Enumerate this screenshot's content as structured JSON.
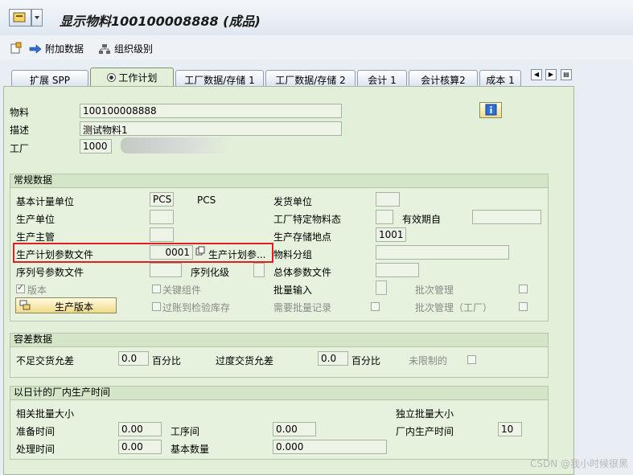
{
  "window": {
    "title": "显示物料100100008888 (成品)"
  },
  "toolbar": {
    "additional_data": "附加数据",
    "org_levels": "组织级别"
  },
  "tabs": [
    {
      "label": "扩展 SPP"
    },
    {
      "label": "工作计划"
    },
    {
      "label": "工厂数据/存储 1"
    },
    {
      "label": "工厂数据/存储 2"
    },
    {
      "label": "会计 1"
    },
    {
      "label": "会计核算2"
    },
    {
      "label": "成本 1"
    }
  ],
  "header": {
    "material_label": "物料",
    "material_value": "100100008888",
    "desc_label": "描述",
    "desc_value": "测试物料1",
    "plant_label": "工厂",
    "plant_value": "1000"
  },
  "general": {
    "title": "常规数据",
    "base_uom_label": "基本计量单位",
    "base_uom_value": "PCS",
    "base_uom_text": "PCS",
    "issue_unit_label": "发货单位",
    "prod_unit_label": "生产单位",
    "plant_status_label": "工厂特定物料态",
    "valid_from_label": "有效期自",
    "supervisor_label": "生产主管",
    "storage_loc_label": "生产存储地点",
    "storage_loc_value": "1001",
    "profile_label": "生产计划参数文件",
    "profile_value": "0001",
    "profile_text": "生产计划参...",
    "mat_group_label": "物料分组",
    "serial_label": "序列号参数文件",
    "serial_level_label": "序列化级",
    "overall_profile_label": "总体参数文件",
    "version_label": "版本",
    "key_comp_label": "关键组件",
    "batch_entry_label": "批量输入",
    "batch_mgmt_label": "批次管理",
    "prod_version_btn": "生产版本",
    "post_inspect_label": "过账到检验库存",
    "batch_record_label": "需要批量记录",
    "batch_mgmt_plant_label": "批次管理（工厂）"
  },
  "tolerance": {
    "title": "容差数据",
    "under_label": "不足交货允差",
    "under_value": "0.0",
    "under_unit": "百分比",
    "over_label": "过度交货允差",
    "over_value": "0.0",
    "over_unit": "百分比",
    "unlimited_label": "未限制的"
  },
  "inhouse": {
    "title": "以日计的厂内生产时间",
    "lot_dep_label": "相关批量大小",
    "lot_indep_label": "独立批量大小",
    "setup_label": "准备时间",
    "setup_value": "0.00",
    "interop_label": "工序间",
    "interop_value": "0.00",
    "inhouse_label": "厂内生产时间",
    "inhouse_value": "10",
    "proc_label": "处理时间",
    "proc_value": "0.00",
    "base_qty_label": "基本数量",
    "base_qty_value": "0.000"
  },
  "watermark": "CSDN @我小时候很黑"
}
